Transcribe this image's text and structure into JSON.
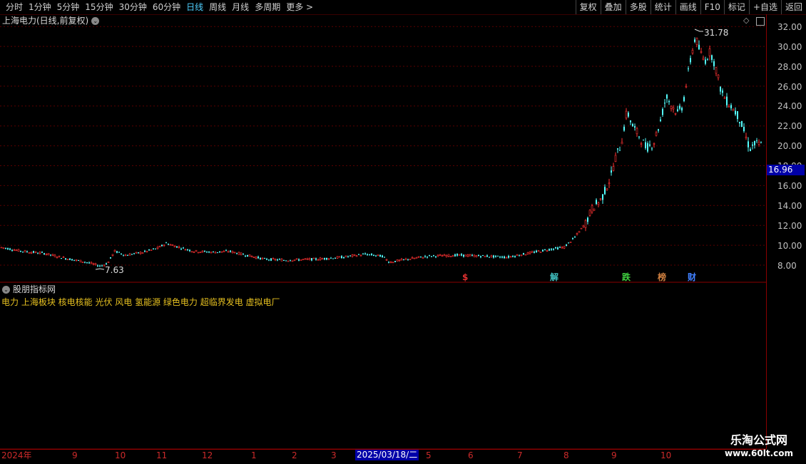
{
  "toolbar": {
    "periods": [
      "分时",
      "1分钟",
      "5分钟",
      "15分钟",
      "30分钟",
      "60分钟",
      "日线",
      "周线",
      "月线",
      "多周期",
      "更多 >"
    ],
    "active_period": "日线",
    "actions": [
      "复权",
      "叠加",
      "多股",
      "统计",
      "画线",
      "F10",
      "标记",
      "+自选",
      "返回"
    ]
  },
  "main": {
    "title": "上海电力(日线,前复权)",
    "high_label": "31.78",
    "low_label": "7.63",
    "current_price": "16.96",
    "price_ticks": [
      "32.00",
      "30.00",
      "28.00",
      "26.00",
      "24.00",
      "22.00",
      "20.00",
      "18.00",
      "16.00",
      "14.00",
      "12.00",
      "10.00",
      "8.00"
    ],
    "events": [
      {
        "text": "$",
        "color": "#e03030"
      },
      {
        "text": "解",
        "color": "#40c0c0"
      },
      {
        "text": "跌",
        "color": "#40d040"
      },
      {
        "text": "榜",
        "color": "#d08040"
      },
      {
        "text": "财",
        "color": "#4080ff"
      }
    ]
  },
  "sub": {
    "title": "股朋指标网",
    "concepts": "电力 上海板块 核电核能 光伏 风电 氢能源 绿色电力 超临界发电 虚拟电厂"
  },
  "date_axis": {
    "labels": [
      "2024年",
      "9",
      "10",
      "11",
      "12",
      "1",
      "2",
      "3",
      "5",
      "6",
      "7",
      "8",
      "9",
      "10"
    ],
    "cursor_date": "2025/03/18/二"
  },
  "watermark": {
    "line1": "乐淘公式网",
    "line2": "www.60lt.com"
  },
  "colors": {
    "up": "#ff3232",
    "down": "#54ffff",
    "grid": "#5a0000",
    "active": "#4fd0ff"
  }
}
